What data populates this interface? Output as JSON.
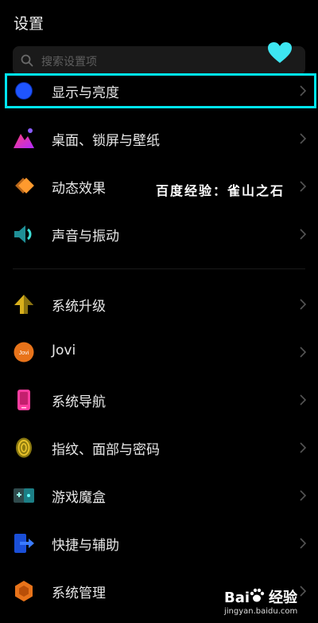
{
  "header": {
    "title": "设置"
  },
  "search": {
    "placeholder": "搜索设置项"
  },
  "groups": [
    {
      "items": [
        {
          "label": "显示与亮度",
          "icon": "display-brightness-icon"
        },
        {
          "label": "桌面、锁屏与壁纸",
          "icon": "wallpaper-icon"
        },
        {
          "label": "动态效果",
          "icon": "motion-effects-icon"
        },
        {
          "label": "声音与振动",
          "icon": "sound-icon"
        }
      ]
    },
    {
      "items": [
        {
          "label": "系统升级",
          "icon": "system-update-icon"
        },
        {
          "label": "Jovi",
          "icon": "jovi-icon"
        },
        {
          "label": "系统导航",
          "icon": "system-navigation-icon"
        },
        {
          "label": "指纹、面部与密码",
          "icon": "fingerprint-icon"
        },
        {
          "label": "游戏魔盒",
          "icon": "game-box-icon"
        },
        {
          "label": "快捷与辅助",
          "icon": "shortcut-icon"
        },
        {
          "label": "系统管理",
          "icon": "system-management-icon"
        }
      ]
    }
  ],
  "watermark": {
    "text": "百度经验：雀山之石"
  },
  "brand": {
    "logo_left": "Bai",
    "logo_right": "经验",
    "url": "jingyan.baidu.com"
  },
  "colors": {
    "highlight": "#00e5f0",
    "background": "#000000",
    "jovi_badge": "Jovi"
  }
}
